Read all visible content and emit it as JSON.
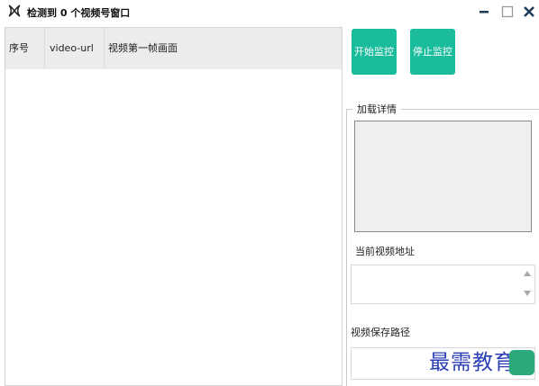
{
  "window": {
    "title": "检测到 0 个视频号窗口",
    "controls": {
      "minimize": "minimize-icon",
      "maximize": "maximize-icon",
      "close": "close-icon"
    }
  },
  "table": {
    "columns": [
      "序号",
      "video-url",
      "视频第一帧画面"
    ],
    "rows": []
  },
  "buttons": {
    "start": "开始监控",
    "stop": "停止监控"
  },
  "details": {
    "group_title": "加载详情",
    "current_video_label": "当前视频地址",
    "current_video_value": "",
    "save_path_label": "视频保存路径",
    "save_path_value": ""
  },
  "watermark": "最需教育",
  "colors": {
    "accent": "#1abc9c",
    "header_bg": "#ececec",
    "watermark": "#2a3fb5"
  }
}
